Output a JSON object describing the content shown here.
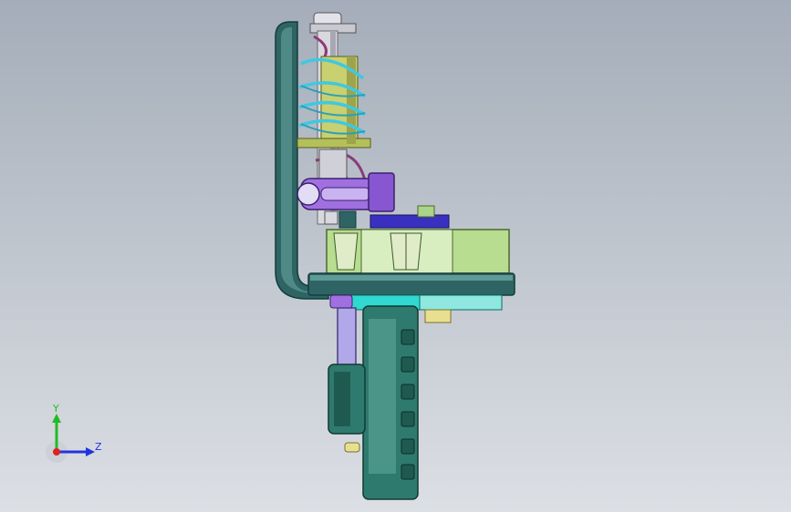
{
  "viewport": {
    "background_top": "#a4adb9",
    "background_bottom": "#dcdfe4"
  },
  "triad": {
    "y_label": "Y",
    "z_label": "Z",
    "y_color": "#22bb22",
    "z_color": "#2233dd",
    "x_color": "#dd2222"
  },
  "model": {
    "colors": {
      "frame": "#2e6464",
      "frame_light": "#5f9a96",
      "spring": "#40c8e0",
      "sleeve": "#c8d070",
      "rod": "#d9d9dd",
      "link": "#a070e0",
      "link_dark": "#3a30c0",
      "block": "#b8dc90",
      "base": "#30d8d0",
      "handle": "#2f7a6e",
      "wire": "#8a3a7a",
      "knob": "#e8a0b0"
    }
  }
}
